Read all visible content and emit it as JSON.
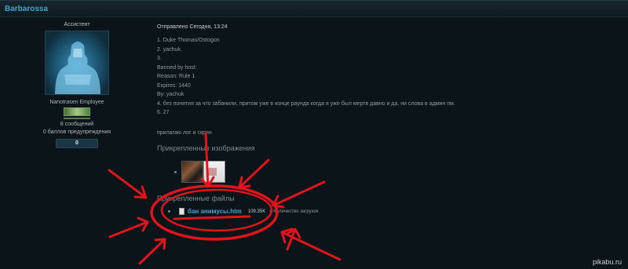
{
  "post": {
    "author": "Barbarossa",
    "role": "Ассистент",
    "user_title": "Nanotrasen Employee",
    "messages": "8 сообщений",
    "warnings": "0 баллов предупреждения",
    "reputation": "0"
  },
  "content": {
    "sent": "Отправлено Сегодня, 13:24",
    "lines": [
      "1. Duke Thomas/Ostogon",
      "2. yachuk.",
      "3.",
      "Banned by host:",
      "Reason: Rule 1",
      "Expires: 1440",
      "By: yachuk",
      "4. без понятия за что забанили, притом уже в конце раунда когда я уже был мертв давно и да, ни слова в админ пм.",
      "6. 27"
    ],
    "note": "прилагаю лог и скрин",
    "images_title": "Прикрепленные изображения",
    "files_title": "Прикрепленные файлы",
    "file_name": "бан анимусы.htm",
    "file_size": "109.35K",
    "file_downloads": "4 Количество загрузок"
  },
  "annotation_color": "#e0141b",
  "watermark": "pikabu.ru"
}
